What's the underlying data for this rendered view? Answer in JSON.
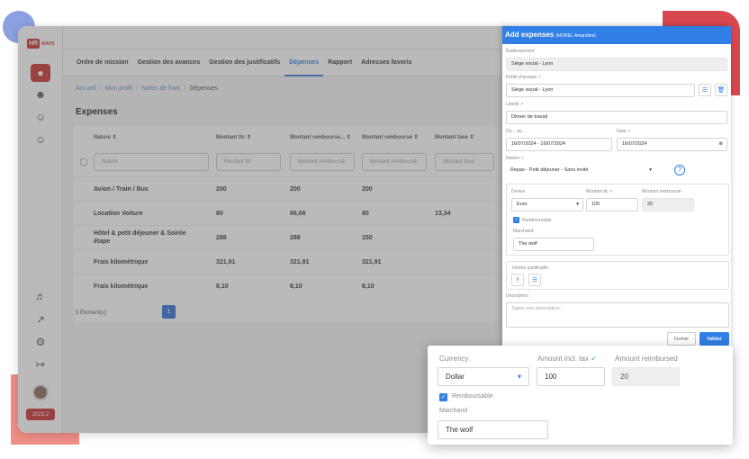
{
  "sidebar": {
    "logo_text": "HR",
    "logo_sub": "MAPS",
    "icons": [
      "person-icon",
      "user-nodes-icon",
      "user-key-icon",
      "user-clock-icon",
      "bell-icon",
      "export-icon",
      "settings-icon",
      "logout-icon"
    ],
    "version": "2023.2"
  },
  "tabs": [
    "Ordre de mission",
    "Gestion des avances",
    "Gestion des justificatifs",
    "Dépenses",
    "Rapport",
    "Adresses favoris"
  ],
  "active_tab": 3,
  "breadcrumb": [
    "Accueil",
    "Mon profil",
    "Notes de frais",
    "Dépenses"
  ],
  "page_title": "Expenses",
  "table": {
    "columns": [
      "Nature",
      "Montant ttc",
      "Montant rembourse...",
      "Montant remboursé",
      "Montant taxe"
    ],
    "filters": [
      "Nature",
      "Montant ttc",
      "Montant remboursé",
      "Montant remboursé",
      "Montant taxe"
    ],
    "rows": [
      [
        "Avion / Train / Bus",
        "200",
        "200",
        "200",
        ""
      ],
      [
        "Location Voiture",
        "80",
        "66,66",
        "80",
        "13,34"
      ],
      [
        "Hôtel & petit déjeuner & Soirée étape",
        "288",
        "288",
        "150",
        ""
      ],
      [
        "Frais kilométrique",
        "321,91",
        "321,91",
        "321,91",
        ""
      ],
      [
        "Frais kilométrique",
        "8,10",
        "8,10",
        "8,10",
        ""
      ]
    ],
    "count_label": "5 Élément(s)",
    "page": "1"
  },
  "panel": {
    "title": "Add expenses",
    "subtitle": "(MOREL Amandine)",
    "etablissement_label": "Établissement",
    "etablissement_value": "Siège social - Lyon",
    "entite_label": "Entité physique",
    "entite_value": "Siège social - Lyon",
    "libelle_label": "Libellé",
    "libelle_value": "Dinner de travail",
    "du_au_label": "Du... au...",
    "du_au_value": "16/07/2024 - 16/07/2024",
    "date_label": "Date",
    "date_value": "16/07/2024",
    "nature_label": "Nature",
    "nature_value": "Repas - Petit déjeuner - Sans invité",
    "devise_label": "Devise",
    "devise_value": "Euro",
    "montant_ttc_label": "Montant ttc",
    "montant_ttc_value": "100",
    "montant_rembourse_label": "Montant remboursé",
    "montant_rembourse_value": "20",
    "remboursable_label": "Remboursable",
    "marchand_label": "Marchand",
    "marchand_value": "The wolf",
    "justificatifs_label": "Joindre justificatifs",
    "description_label": "Description",
    "description_placeholder": "Tapez une description...",
    "cancel_label": "Fermer",
    "submit_label": "Valider"
  },
  "zoom": {
    "currency_label": "Currency",
    "currency_value": "Dollar",
    "amount_ttc_label": "Amount incl. tax",
    "amount_ttc_value": "100",
    "amount_reimbursed_label": "Amount reimbursed",
    "amount_reimbursed_value": "20",
    "remboursable_label": "Remboursable",
    "marchand_label": "Marchand",
    "marchand_value": "The wolf"
  },
  "colors": {
    "brand_red": "#c82f2f",
    "accent_blue": "#2f7fe6",
    "valid_green": "#2f9e5a"
  }
}
